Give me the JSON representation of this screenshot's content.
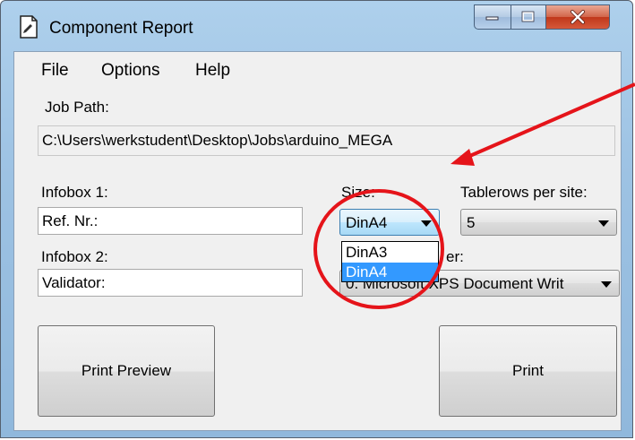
{
  "window": {
    "title": "Component Report"
  },
  "menu": {
    "items": [
      "File",
      "Options",
      "Help"
    ]
  },
  "job_path": {
    "label": "Job Path:",
    "value": "C:\\Users\\werkstudent\\Desktop\\Jobs\\arduino_MEGA"
  },
  "infobox1": {
    "label": "Infobox 1:",
    "value": "Ref. Nr.:"
  },
  "infobox2": {
    "label": "Infobox 2:",
    "value": "Validator:"
  },
  "size": {
    "label": "Size:",
    "selected": "DinA4",
    "options": [
      "DinA3",
      "DinA4"
    ],
    "highlighted": "DinA4"
  },
  "tablerows": {
    "label": "Tablerows per site:",
    "selected": "5"
  },
  "printer": {
    "label_visible_fragment": "er:",
    "selected_visible_fragment": "0. Microsoft XPS Document Writ"
  },
  "buttons": {
    "print_preview": "Print Preview",
    "print": "Print"
  },
  "annotation": {
    "color": "#e5141a"
  }
}
